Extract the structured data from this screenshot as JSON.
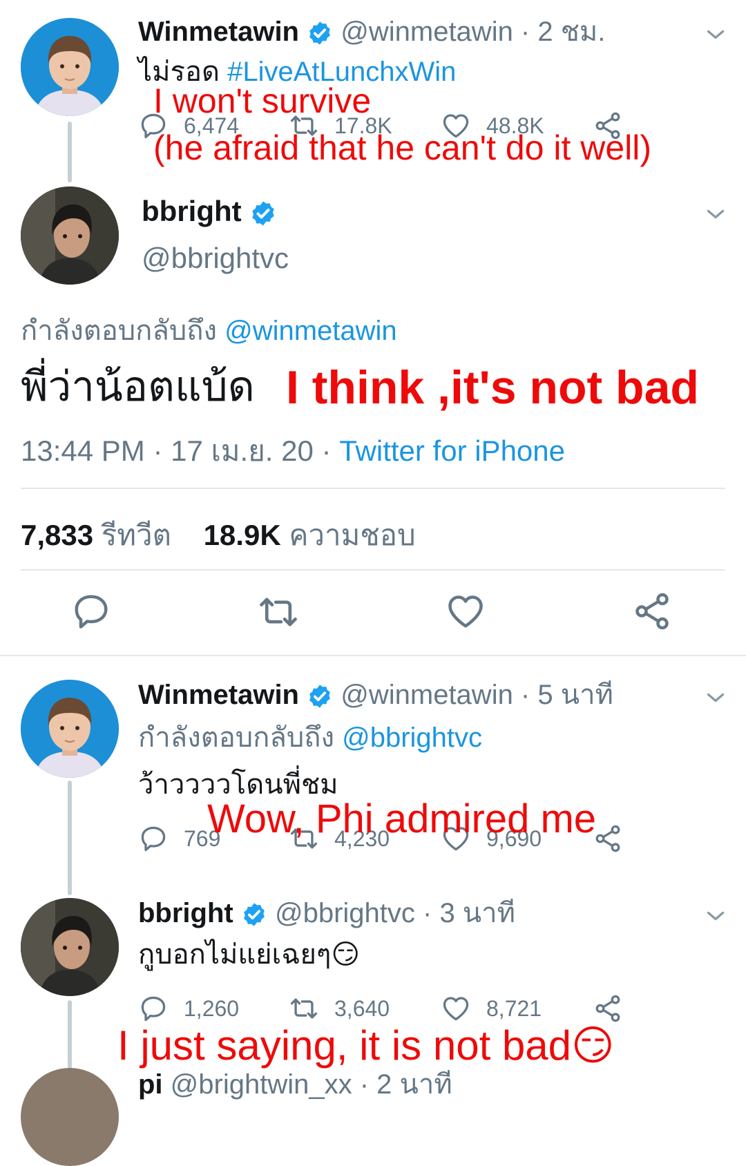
{
  "colors": {
    "link": "#1b95e0",
    "muted": "#657786",
    "text": "#14171a",
    "overlay": "#ee0a0a",
    "verified": "#1da1f2"
  },
  "tweet1": {
    "name": "Winmetawin",
    "handle": "@winmetawin · 2 ชม.",
    "text_prefix": "ไม่รอด ",
    "hashtag": "#LiveAtLunchxWin",
    "replies": "6,474",
    "retweets": "17.8K",
    "likes": "48.8K",
    "overlay_line1": "I won't survive",
    "overlay_line2": "(he afraid that he can't do it well)"
  },
  "focused": {
    "name": "bbright",
    "handle": "@bbrightvc",
    "replying_label": "กำลังตอบกลับถึง",
    "replying_to": "@winmetawin",
    "text": "พี่ว่าน้อตแบ้ด",
    "overlay": "I think ,it's not bad",
    "time_date": "13:44 PM · 17 เม.ย. 20 · ",
    "source": "Twitter for iPhone",
    "retweet_count": "7,833",
    "retweet_label": "รีทวีต",
    "like_count": "18.9K",
    "like_label": "ความชอบ"
  },
  "tweet2": {
    "name": "Winmetawin",
    "handle": "@winmetawin · 5 นาที",
    "replying_label": "กำลังตอบกลับถึง",
    "replying_to": "@bbrightvc",
    "text": "ว้าววววโดนพี่ชม",
    "replies": "769",
    "retweets": "4,230",
    "likes": "9,690",
    "overlay": "Wow, Phi admired me"
  },
  "tweet3": {
    "name": "bbright",
    "handle": "@bbrightvc · 3 นาที",
    "text": "กูบอกไม่แย่เฉยๆ😏",
    "replies": "1,260",
    "retweets": "3,640",
    "likes": "8,721",
    "overlay": "I just saying, it is not bad😏"
  },
  "tweet4_partial": {
    "name": "pi",
    "handle": "@brightwin_xx · 2 นาที"
  },
  "icons": [
    "verified-badge-icon",
    "chevron-down-icon",
    "reply-icon",
    "retweet-icon",
    "like-icon",
    "share-icon"
  ]
}
